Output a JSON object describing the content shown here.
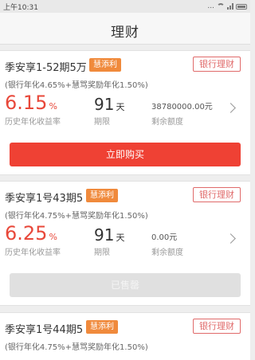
{
  "status_bar": {
    "time": "上午10:31",
    "dots": "..."
  },
  "header": {
    "title": "理财"
  },
  "products": [
    {
      "name": "季安享1-52期5万",
      "tag": "慧添利",
      "badge": "银行理财",
      "rate_desc": "(银行年化4.65%+慧骂奖励年化1.50%)",
      "rate": "6.15",
      "rate_unit": "%",
      "rate_label": "历史年化收益率",
      "term": "91",
      "term_unit": "天",
      "term_label": "期限",
      "remaining": "38780000.00元",
      "remaining_label": "剩余额度",
      "button_label": "立即购买",
      "button_state": "active"
    },
    {
      "name": "季安享1号43期5",
      "tag": "慧添利",
      "badge": "银行理财",
      "rate_desc": "(银行年化4.75%+慧骂奖励年化1.50%)",
      "rate": "6.25",
      "rate_unit": "%",
      "rate_label": "历史年化收益率",
      "term": "91",
      "term_unit": "天",
      "term_label": "期限",
      "remaining": "0.00元",
      "remaining_label": "剩余额度",
      "button_label": "已售罄",
      "button_state": "disabled"
    },
    {
      "name": "季安享1号44期5",
      "tag": "慧添利",
      "badge": "银行理财",
      "rate_desc": "(银行年化4.75%+慧骂奖励年化1.50%)"
    }
  ],
  "colors": {
    "accent_red": "#ef4134",
    "tag_orange": "#f08a3c",
    "badge_red": "#e06a6a",
    "sold_gray": "#e0e0e0"
  }
}
